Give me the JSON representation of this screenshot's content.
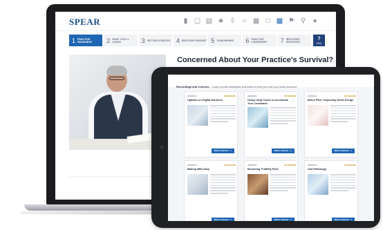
{
  "brand": {
    "name": "SPEAR",
    "color": "#1b4f86"
  },
  "header_icons": [
    "bar-chart-icon",
    "monitor-icon",
    "book-icon",
    "tooth-icon",
    "download-icon",
    "chat-icon",
    "calendar-icon",
    "document-icon",
    "grid-icon",
    "bookmark-icon",
    "search-icon",
    "user-icon"
  ],
  "steps": [
    {
      "num": "1",
      "label": "PRACTICE READINESS",
      "active": true
    },
    {
      "num": "2",
      "label": "WHAT YOU'LL LEARN",
      "active": false
    },
    {
      "num": "3",
      "label": "GETTING STARTED",
      "active": false
    },
    {
      "num": "4",
      "label": "RECOVERY BUDGET",
      "active": false
    },
    {
      "num": "5",
      "label": "TEAM BEHIND",
      "active": false
    },
    {
      "num": "6",
      "label": "PRACTICE LEADERSHIP",
      "active": false
    },
    {
      "num": "7",
      "label": "RECOVERY INITIATIVES",
      "active": false
    }
  ],
  "faq": {
    "label": "FAQ"
  },
  "page_title": "Concerned About Your Practice's Survival?",
  "recordings": {
    "title": "Recordings and Courses",
    "subtitle": " – Learn crucial strategies and skills to help you and your team succeed"
  },
  "cards": [
    {
      "type": "WEBINAR",
      "badge": "ON DEMAND",
      "title": "Updates on Digital Dentures",
      "button": "Watch webinar"
    },
    {
      "type": "WEBINAR",
      "badge": "ON DEMAND",
      "title": "Using Large Cases to Accelerate Your Comeback",
      "button": "Watch webinar"
    },
    {
      "type": "WEBINAR",
      "badge": "ON DEMAND",
      "title": "Botox Filler: Improving Smile Design",
      "button": "Watch webinar"
    },
    {
      "type": "WEBINAR",
      "badge": "ON DEMAND",
      "title": "Making MRs Easy",
      "button": "Watch webinar"
    },
    {
      "type": "WEBINAR",
      "badge": "ON DEMAND",
      "title": "Becoming 'Fulfillity Rich'",
      "button": "Watch webinar"
    },
    {
      "type": "WEBINAR",
      "badge": "ON DEMAND",
      "title": "Oral Pathology",
      "button": "Watch webinar"
    }
  ],
  "colors": {
    "accent": "#1f66b3",
    "badge": "#c69214",
    "faq": "#1f3f7a"
  }
}
